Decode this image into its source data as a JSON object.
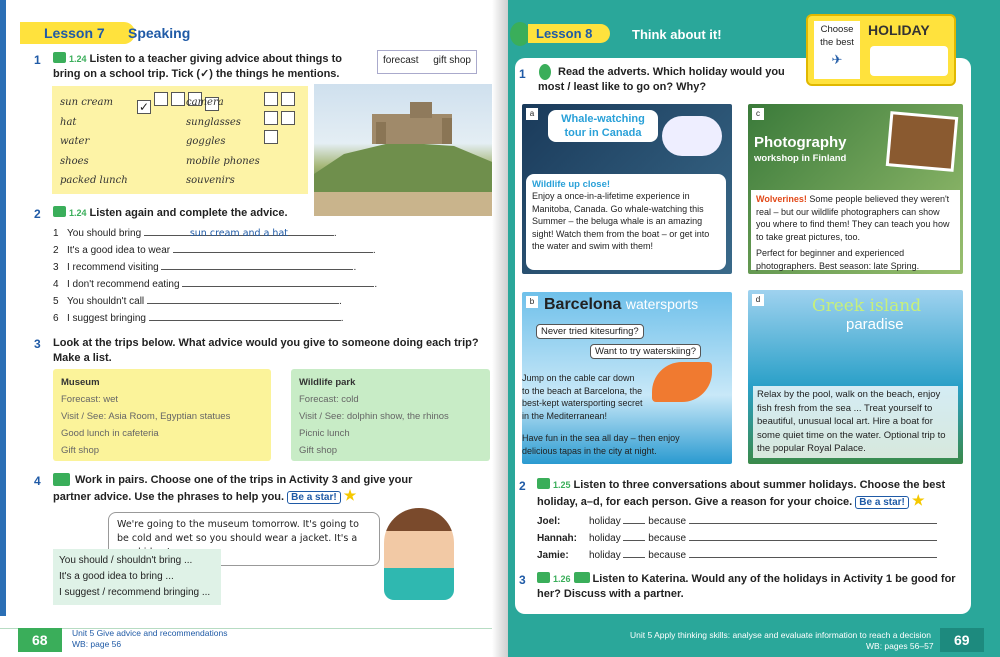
{
  "left": {
    "lesson_label": "Lesson 7",
    "lesson_title": "Speaking",
    "ex1": {
      "num": "1",
      "track": "1.24",
      "instruction": "Listen to a teacher giving advice about things to bring on a school trip. Tick (✓) the things he mentions.",
      "items_left": [
        "sun cream",
        "hat",
        "water",
        "shoes",
        "packed lunch"
      ],
      "items_right": [
        "camera",
        "sunglasses",
        "goggles",
        "mobile phones",
        "souvenirs"
      ],
      "checked": "✓",
      "wordbox": [
        "forecast",
        "gift shop"
      ]
    },
    "ex2": {
      "num": "2",
      "track": "1.24",
      "instruction": "Listen again and complete the advice.",
      "lines": [
        {
          "n": "1",
          "t": "You should bring",
          "ans": "sun cream and a hat"
        },
        {
          "n": "2",
          "t": "It's a good idea to wear"
        },
        {
          "n": "3",
          "t": "I recommend visiting"
        },
        {
          "n": "4",
          "t": "I don't recommend eating"
        },
        {
          "n": "5",
          "t": "You shouldn't call"
        },
        {
          "n": "6",
          "t": "I suggest bringing"
        }
      ]
    },
    "ex3": {
      "num": "3",
      "instruction": "Look at the trips below. What advice would you give to someone doing each trip? Make a list.",
      "museum": {
        "title": "Museum",
        "lines": [
          "Forecast: wet",
          "Visit / See: Asia Room, Egyptian statues",
          "Good lunch in cafeteria",
          "Gift shop"
        ]
      },
      "wildlife": {
        "title": "Wildlife park",
        "lines": [
          "Forecast: cold",
          "Visit / See: dolphin show, the rhinos",
          "Picnic lunch",
          "Gift shop"
        ]
      }
    },
    "ex4": {
      "num": "4",
      "instruction": "Work in pairs. Choose one of the trips in Activity 3 and give your partner advice. Use the phrases to help you.",
      "star": "Be a star!",
      "bubble": "We're going to the museum tomorrow. It's going to be cold and wet so you should wear a jacket. It's a good idea to ...",
      "phrases": [
        "You should / shouldn't bring ...",
        "It's a good idea to bring ...",
        "I suggest / recommend bringing ..."
      ]
    },
    "footer": {
      "page": "68",
      "unit": "Unit 5  Give advice and recommendations",
      "wb": "WB: page 56"
    }
  },
  "right": {
    "lesson_label": "Lesson 8",
    "lesson_title": "Think about it!",
    "badge": {
      "line1": "Choose",
      "line2": "the best",
      "word": "HOLIDAY"
    },
    "ex1": {
      "num": "1",
      "instruction": "Read the adverts. Which holiday would you most / least like to go on? Why?"
    },
    "ads": {
      "a": {
        "letter": "a",
        "title": "Whale-watching tour in Canada",
        "head": "Wildlife up close!",
        "body": "Enjoy a once-in-a-lifetime experience in Manitoba, Canada. Go whale-watching this Summer – the beluga whale is an amazing sight! Watch them from the boat – or get into the water and swim with them!"
      },
      "b": {
        "letter": "b",
        "title1": "Barcelona",
        "title2": "watersports",
        "b1": "Never tried kitesurfing?",
        "b2": "Want to try waterskiing?",
        "body1": "Jump on the cable car down to the beach at Barcelona, the best-kept watersporting secret in the Mediterranean!",
        "body2": "Have fun in the sea all day – then enjoy delicious tapas in the city at night."
      },
      "c": {
        "letter": "c",
        "title1": "Photography",
        "title2": "workshop in Finland",
        "head": "Wolverines!",
        "body": "Some people believed they weren't real – but our wildlife photographers can show you where to find them! They can teach you how to take great pictures, too.",
        "body2": "Perfect for beginner and experienced photographers. Best season: late Spring."
      },
      "d": {
        "letter": "d",
        "title1": "Greek island",
        "title2": "paradise",
        "body": "Relax by the pool, walk on the beach, enjoy fish fresh from the sea ... Treat yourself to beautiful, unusual local art. Hire a boat for some quiet time on the water. Optional trip to the popular Royal Palace."
      }
    },
    "ex2": {
      "num": "2",
      "track": "1.25",
      "instruction": "Listen to three conversations about summer holidays. Choose the best holiday, a–d, for each person. Give a reason for your choice.",
      "star": "Be a star!",
      "people": [
        "Joel:",
        "Hannah:",
        "Jamie:"
      ],
      "w1": "holiday",
      "w2": "because"
    },
    "ex3": {
      "num": "3",
      "track": "1.26",
      "instruction": "Listen to Katerina. Would any of the holidays in Activity 1 be good for her? Discuss with a partner."
    },
    "footer": {
      "page": "69",
      "unit": "Unit 5  Apply thinking skills: analyse and evaluate information to reach a decision",
      "wb": "WB: pages 56–57"
    }
  }
}
